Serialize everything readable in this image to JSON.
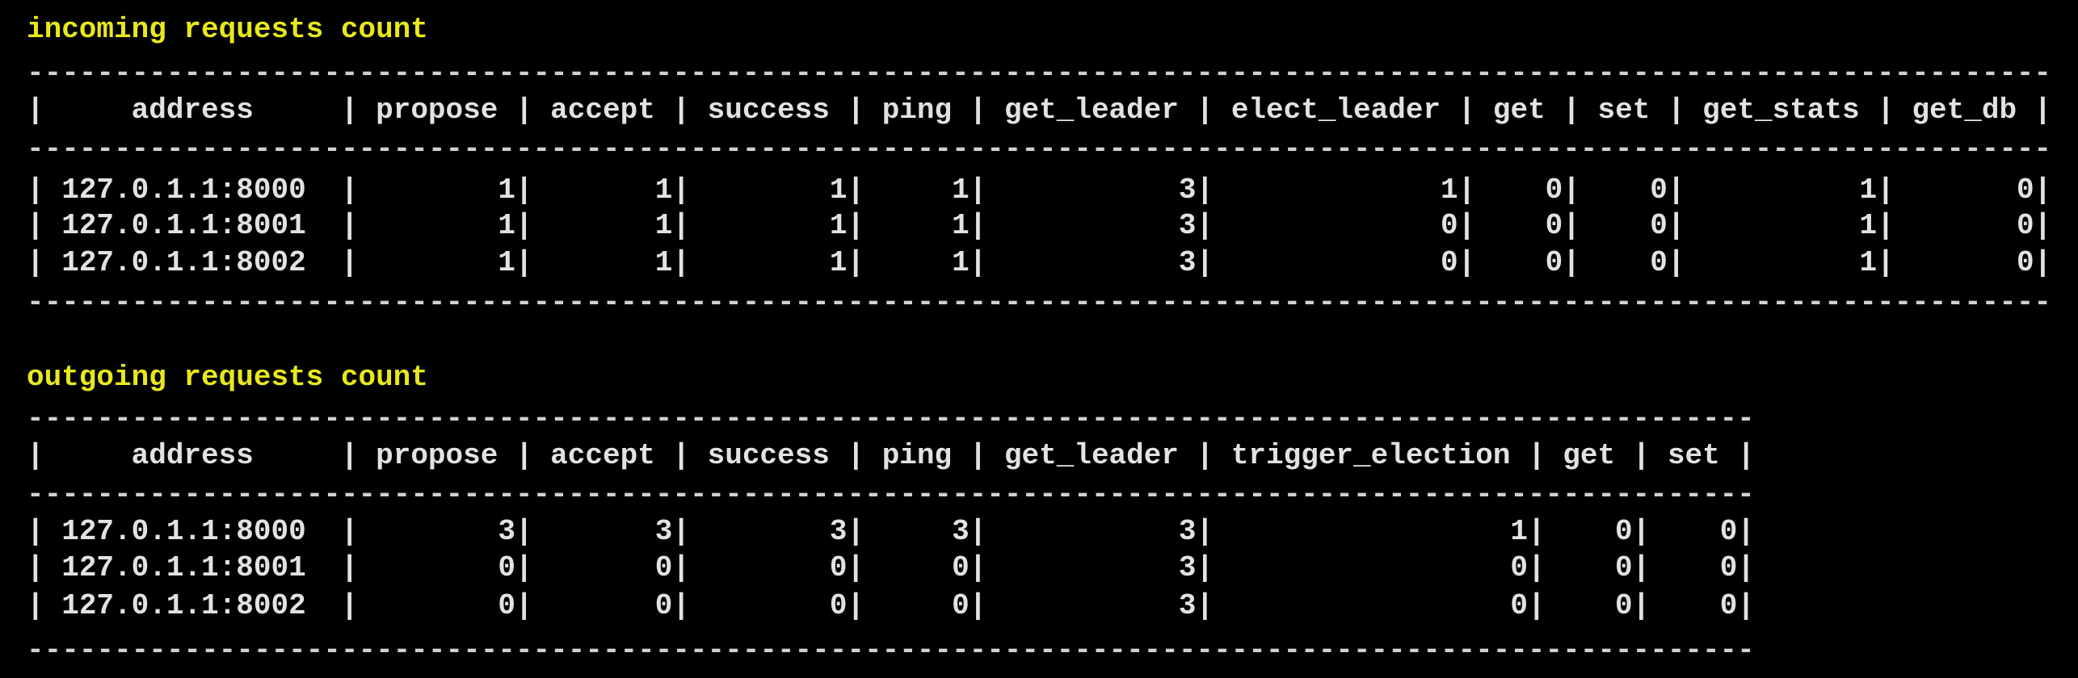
{
  "colors": {
    "title": "#e8e81c",
    "text": "#e2e2e2",
    "background": "#000000"
  },
  "tables": [
    {
      "title": "incoming requests count",
      "columns": [
        "address",
        "propose",
        "accept",
        "success",
        "ping",
        "get_leader",
        "elect_leader",
        "get",
        "set",
        "get_stats",
        "get_db"
      ],
      "rows": [
        [
          "127.0.1.1:8000",
          "1",
          "1",
          "1",
          "1",
          "3",
          "1",
          "0",
          "0",
          "1",
          "0"
        ],
        [
          "127.0.1.1:8001",
          "1",
          "1",
          "1",
          "1",
          "3",
          "0",
          "0",
          "0",
          "1",
          "0"
        ],
        [
          "127.0.1.1:8002",
          "1",
          "1",
          "1",
          "1",
          "3",
          "0",
          "0",
          "0",
          "1",
          "0"
        ]
      ]
    },
    {
      "title": "outgoing requests count",
      "columns": [
        "address",
        "propose",
        "accept",
        "success",
        "ping",
        "get_leader",
        "trigger_election",
        "get",
        "set"
      ],
      "rows": [
        [
          "127.0.1.1:8000",
          "3",
          "3",
          "3",
          "3",
          "3",
          "1",
          "0",
          "0"
        ],
        [
          "127.0.1.1:8001",
          "0",
          "0",
          "0",
          "0",
          "3",
          "0",
          "0",
          "0"
        ],
        [
          "127.0.1.1:8002",
          "0",
          "0",
          "0",
          "0",
          "3",
          "0",
          "0",
          "0"
        ]
      ]
    }
  ]
}
